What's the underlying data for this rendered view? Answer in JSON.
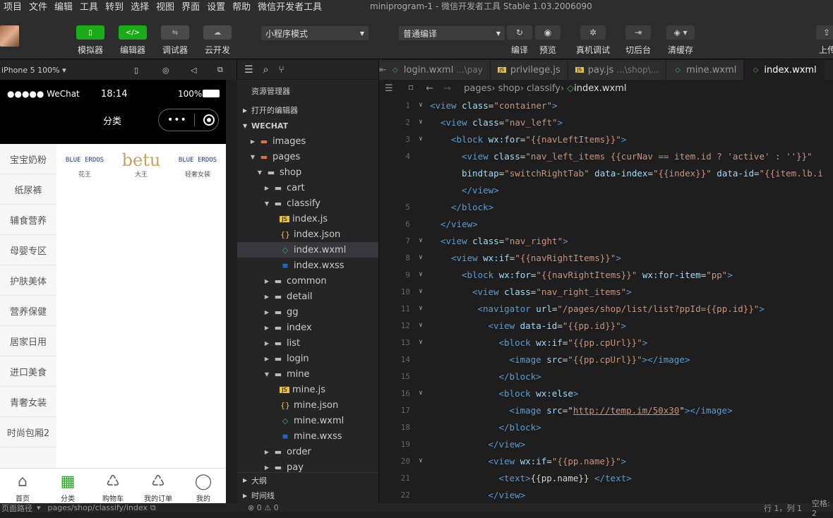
{
  "menubar": {
    "items": [
      "项目",
      "文件",
      "编辑",
      "工具",
      "转到",
      "选择",
      "视图",
      "界面",
      "设置",
      "帮助",
      "微信开发者工具"
    ],
    "title": "miniprogram-1 - 微信开发者工具 Stable 1.03.2006090"
  },
  "toolbar": {
    "simulator": "模拟器",
    "editor": "编辑器",
    "debugger": "调试器",
    "cloud": "云开发",
    "mode": "小程序模式",
    "compile_mode": "普通编译",
    "compile": "编译",
    "preview": "预览",
    "real_debug": "真机调试",
    "background": "切后台",
    "clear_cache": "清缓存",
    "upload": "上传"
  },
  "simulator": {
    "device": "iPhone 5 100%",
    "carrier": "●●●●● WeChat",
    "time": "18:14",
    "battery": "100%",
    "nav_title": "分类",
    "categories": [
      "宝宝奶粉",
      "纸尿裤",
      "辅食营养",
      "母婴专区",
      "护肤美体",
      "营养保健",
      "居家日用",
      "进口美食",
      "青奢女装",
      "时尚包厢2"
    ],
    "brands": [
      {
        "logo": "BLUE ERDOS",
        "name": "花王"
      },
      {
        "logo": "betu",
        "name": "大王"
      },
      {
        "logo": "BLUE ERDOS",
        "name": "轻奢女装"
      }
    ],
    "tabs": [
      "首页",
      "分类",
      "购物车",
      "我的订单",
      "我的"
    ],
    "footer_path_label": "页面路径",
    "footer_path": "pages/shop/classify/index"
  },
  "explorer": {
    "title": "资源管理器",
    "open_editors": "打开的编辑器",
    "project": "WECHAT",
    "outline": "大纲",
    "timeline": "时间线",
    "tree": [
      {
        "name": "images",
        "depth": 1,
        "type": "folder-special",
        "open": false
      },
      {
        "name": "pages",
        "depth": 1,
        "type": "folder-special",
        "open": true
      },
      {
        "name": "shop",
        "depth": 2,
        "type": "folder",
        "open": true
      },
      {
        "name": "cart",
        "depth": 3,
        "type": "folder",
        "open": false
      },
      {
        "name": "classify",
        "depth": 3,
        "type": "folder",
        "open": true
      },
      {
        "name": "index.js",
        "depth": 4,
        "type": "js"
      },
      {
        "name": "index.json",
        "depth": 4,
        "type": "json"
      },
      {
        "name": "index.wxml",
        "depth": 4,
        "type": "wxml",
        "selected": true
      },
      {
        "name": "index.wxss",
        "depth": 4,
        "type": "wxss"
      },
      {
        "name": "common",
        "depth": 3,
        "type": "folder",
        "open": false
      },
      {
        "name": "detail",
        "depth": 3,
        "type": "folder",
        "open": false
      },
      {
        "name": "gg",
        "depth": 3,
        "type": "folder",
        "open": false
      },
      {
        "name": "index",
        "depth": 3,
        "type": "folder",
        "open": false
      },
      {
        "name": "list",
        "depth": 3,
        "type": "folder",
        "open": false
      },
      {
        "name": "login",
        "depth": 3,
        "type": "folder",
        "open": false
      },
      {
        "name": "mine",
        "depth": 3,
        "type": "folder",
        "open": true
      },
      {
        "name": "mine.js",
        "depth": 4,
        "type": "js"
      },
      {
        "name": "mine.json",
        "depth": 4,
        "type": "json"
      },
      {
        "name": "mine.wxml",
        "depth": 4,
        "type": "wxml"
      },
      {
        "name": "mine.wxss",
        "depth": 4,
        "type": "wxss"
      },
      {
        "name": "order",
        "depth": 3,
        "type": "folder",
        "open": false
      },
      {
        "name": "pay",
        "depth": 3,
        "type": "folder",
        "open": false
      }
    ]
  },
  "editor": {
    "tabs": [
      {
        "name": "login.wxml",
        "sub": "...\\pay",
        "type": "wxml"
      },
      {
        "name": "privilege.js",
        "sub": "",
        "type": "js"
      },
      {
        "name": "pay.js",
        "sub": "...\\shop\\...",
        "type": "js"
      },
      {
        "name": "mine.wxml",
        "sub": "",
        "type": "wxml"
      },
      {
        "name": "index.wxml",
        "sub": "",
        "type": "wxml",
        "active": true
      }
    ],
    "breadcrumbs": [
      "pages",
      "shop",
      "classify",
      "index.wxml"
    ],
    "lines": [
      {
        "n": "1",
        "fold": true,
        "indent": 0,
        "parts": [
          [
            "t",
            "<view "
          ],
          [
            "a",
            "class"
          ],
          [
            "p",
            "="
          ],
          [
            "s",
            "\"container\""
          ],
          [
            "t",
            ">"
          ]
        ]
      },
      {
        "n": "2",
        "fold": true,
        "indent": 1,
        "parts": [
          [
            "t",
            "<view "
          ],
          [
            "a",
            "class"
          ],
          [
            "p",
            "="
          ],
          [
            "s",
            "\"nav_left\""
          ],
          [
            "t",
            ">"
          ]
        ]
      },
      {
        "n": "3",
        "fold": true,
        "indent": 2,
        "parts": [
          [
            "t",
            "<block "
          ],
          [
            "a",
            "wx:for"
          ],
          [
            "p",
            "="
          ],
          [
            "s",
            "\"{{navLeftItems}}\""
          ],
          [
            "t",
            ">"
          ]
        ]
      },
      {
        "n": "4",
        "fold": false,
        "indent": 3,
        "parts": [
          [
            "t",
            "<view "
          ],
          [
            "a",
            "class"
          ],
          [
            "p",
            "="
          ],
          [
            "s",
            "\"nav_left_items {{curNav == item.id ? 'active' : ''}}\""
          ]
        ]
      },
      {
        "n": "",
        "fold": false,
        "indent": 3,
        "parts": [
          [
            "a",
            "bindtap"
          ],
          [
            "p",
            "="
          ],
          [
            "s",
            "\"switchRightTab\""
          ],
          [
            "p",
            " "
          ],
          [
            "a",
            "data-index"
          ],
          [
            "p",
            "="
          ],
          [
            "s",
            "\"{{index}}\""
          ],
          [
            "p",
            " "
          ],
          [
            "a",
            "data-id"
          ],
          [
            "p",
            "="
          ],
          [
            "s",
            "\"{{item.lb.i"
          ]
        ]
      },
      {
        "n": "",
        "fold": false,
        "indent": 3,
        "parts": [
          [
            "t",
            "</view>"
          ]
        ]
      },
      {
        "n": "5",
        "fold": false,
        "indent": 2,
        "parts": [
          [
            "t",
            "</block>"
          ]
        ]
      },
      {
        "n": "6",
        "fold": false,
        "indent": 1,
        "parts": [
          [
            "t",
            "</view>"
          ]
        ]
      },
      {
        "n": "7",
        "fold": true,
        "indent": 1,
        "parts": [
          [
            "t",
            "<view "
          ],
          [
            "a",
            "class"
          ],
          [
            "p",
            "="
          ],
          [
            "s",
            "\"nav_right\""
          ],
          [
            "t",
            ">"
          ]
        ]
      },
      {
        "n": "8",
        "fold": true,
        "indent": 2,
        "parts": [
          [
            "t",
            "<view "
          ],
          [
            "a",
            "wx:if"
          ],
          [
            "p",
            "="
          ],
          [
            "s",
            "\"{{navRightItems}}\""
          ],
          [
            "t",
            ">"
          ]
        ]
      },
      {
        "n": "9",
        "fold": true,
        "indent": 3,
        "parts": [
          [
            "t",
            "<block "
          ],
          [
            "a",
            "wx:for"
          ],
          [
            "p",
            "="
          ],
          [
            "s",
            "\"{{navRightItems}}\""
          ],
          [
            "p",
            " "
          ],
          [
            "a",
            "wx:for-item"
          ],
          [
            "p",
            "="
          ],
          [
            "s",
            "\"pp\""
          ],
          [
            "t",
            ">"
          ]
        ]
      },
      {
        "n": "10",
        "fold": true,
        "indent": 4,
        "parts": [
          [
            "t",
            "<view "
          ],
          [
            "a",
            "class"
          ],
          [
            "p",
            "="
          ],
          [
            "s",
            "\"nav_right_items\""
          ],
          [
            "t",
            ">"
          ]
        ]
      },
      {
        "n": "11",
        "fold": true,
        "indent": 4.5,
        "parts": [
          [
            "t",
            "<navigator "
          ],
          [
            "a",
            "url"
          ],
          [
            "p",
            "="
          ],
          [
            "s",
            "\"/pages/shop/list/list?ppId={{pp.id}}\""
          ],
          [
            "t",
            ">"
          ]
        ]
      },
      {
        "n": "12",
        "fold": true,
        "indent": 5.5,
        "parts": [
          [
            "t",
            "<view "
          ],
          [
            "a",
            "data-id"
          ],
          [
            "p",
            "="
          ],
          [
            "s",
            "\"{{pp.id}}\""
          ],
          [
            "t",
            ">"
          ]
        ]
      },
      {
        "n": "13",
        "fold": true,
        "indent": 6.5,
        "parts": [
          [
            "t",
            "<block "
          ],
          [
            "a",
            "wx:if"
          ],
          [
            "p",
            "="
          ],
          [
            "s",
            "\"{{pp.cpUrl}}\""
          ],
          [
            "t",
            ">"
          ]
        ]
      },
      {
        "n": "14",
        "fold": false,
        "indent": 7.5,
        "parts": [
          [
            "t",
            "<image "
          ],
          [
            "a",
            "src"
          ],
          [
            "p",
            "="
          ],
          [
            "s",
            "\"{{pp.cpUrl}}\""
          ],
          [
            "t",
            "></image>"
          ]
        ]
      },
      {
        "n": "15",
        "fold": false,
        "indent": 6.5,
        "parts": [
          [
            "t",
            "</block>"
          ]
        ]
      },
      {
        "n": "16",
        "fold": true,
        "indent": 6.5,
        "parts": [
          [
            "t",
            "<block "
          ],
          [
            "a",
            "wx:else"
          ],
          [
            "t",
            ">"
          ]
        ]
      },
      {
        "n": "17",
        "fold": false,
        "indent": 7.5,
        "parts": [
          [
            "t",
            "<image "
          ],
          [
            "a",
            "src"
          ],
          [
            "p",
            "="
          ],
          [
            "p",
            "\""
          ],
          [
            "u",
            "http://temp.im/50x30"
          ],
          [
            "p",
            "\""
          ],
          [
            "t",
            "></image>"
          ]
        ]
      },
      {
        "n": "18",
        "fold": false,
        "indent": 6.5,
        "parts": [
          [
            "t",
            "</block>"
          ]
        ]
      },
      {
        "n": "19",
        "fold": false,
        "indent": 5.5,
        "parts": [
          [
            "t",
            "</view>"
          ]
        ]
      },
      {
        "n": "20",
        "fold": true,
        "indent": 5.5,
        "parts": [
          [
            "t",
            "<view "
          ],
          [
            "a",
            "wx:if"
          ],
          [
            "p",
            "="
          ],
          [
            "s",
            "\"{{pp.name}}\""
          ],
          [
            "t",
            ">"
          ]
        ]
      },
      {
        "n": "21",
        "fold": false,
        "indent": 6.5,
        "parts": [
          [
            "t",
            "<text>"
          ],
          [
            "p",
            "{{pp.name}}  "
          ],
          [
            "t",
            "</text>"
          ]
        ]
      },
      {
        "n": "22",
        "fold": false,
        "indent": 5.5,
        "parts": [
          [
            "t",
            "</view>"
          ]
        ]
      }
    ]
  },
  "statusbar": {
    "errors": "⊗ 0 ⚠ 0",
    "position": "行 1，列 1",
    "spaces": "空格: 2"
  }
}
